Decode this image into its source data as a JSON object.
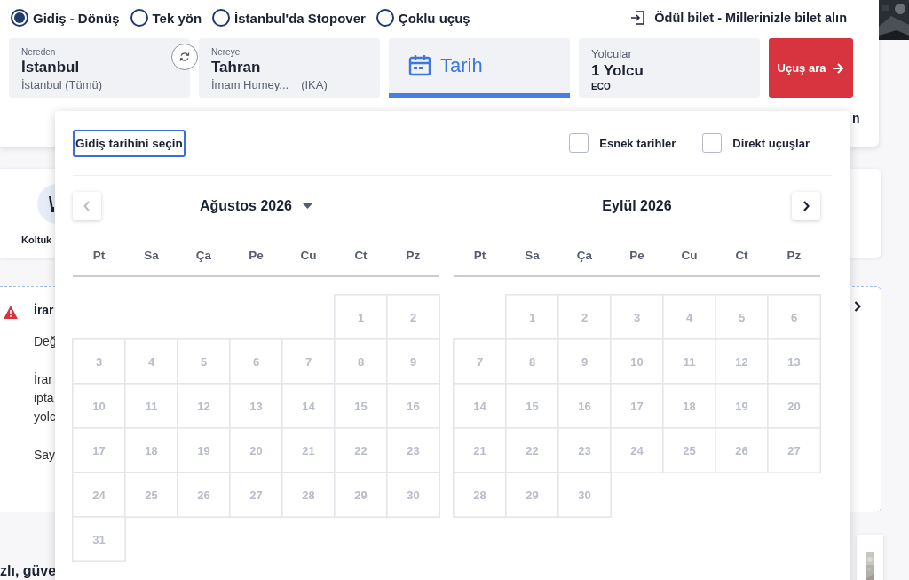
{
  "trip_types": [
    {
      "label": "Gidiş - Dönüş",
      "selected": true
    },
    {
      "label": "Tek yön",
      "selected": false
    },
    {
      "label": "İstanbul'da Stopover",
      "selected": false
    },
    {
      "label": "Çoklu uçuş",
      "selected": false
    }
  ],
  "award_link": {
    "label": "Ödül bilet - Millerinizle bilet alın"
  },
  "search": {
    "origin": {
      "label": "Nereden",
      "city": "İstanbul",
      "airport": "İstanbul (Tümü)"
    },
    "destination": {
      "label": "Nereye",
      "city": "Tahran",
      "airport": "İmam Humey...",
      "code": "(IKA)"
    },
    "date": {
      "label": "Tarih",
      "selected": true
    },
    "passengers": {
      "label": "Yolcular",
      "count": "1 Yolcu",
      "cabin": "ECO"
    },
    "button": "Uçuş ara"
  },
  "background": {
    "header_fragment": "n",
    "services": [
      {
        "label": "Koltuk"
      }
    ],
    "notice": {
      "title": "İrar",
      "paragraphs": [
        [
          "Değ"
        ],
        [
          "İrar",
          "ipta",
          "yolc"
        ],
        [
          "Say"
        ]
      ]
    },
    "footer_heading": "zlı, güve"
  },
  "date_picker": {
    "prompt": "Gidiş tarihini seçin",
    "options": [
      {
        "label": "Esnek tarihler",
        "checked": false
      },
      {
        "label": "Direkt uçuşlar",
        "checked": false
      }
    ],
    "prev": {
      "disabled": true
    },
    "next": {
      "disabled": false
    },
    "months": [
      {
        "title": "Ağustos 2026",
        "dropdown": true,
        "weekdays": [
          "Pt",
          "Sa",
          "Ça",
          "Pe",
          "Cu",
          "Ct",
          "Pz"
        ],
        "days": [
          {
            "kind": "blank"
          },
          {
            "kind": "blank"
          },
          {
            "kind": "blank"
          },
          {
            "kind": "blank"
          },
          {
            "kind": "blank"
          },
          {
            "kind": "day",
            "label": "1",
            "disabled": true
          },
          {
            "kind": "day",
            "label": "2",
            "disabled": true
          },
          {
            "kind": "day",
            "label": "3",
            "disabled": true
          },
          {
            "kind": "day",
            "label": "4",
            "disabled": true
          },
          {
            "kind": "day",
            "label": "5",
            "disabled": true
          },
          {
            "kind": "day",
            "label": "6",
            "disabled": true
          },
          {
            "kind": "day",
            "label": "7",
            "disabled": true
          },
          {
            "kind": "day",
            "label": "8",
            "disabled": true
          },
          {
            "kind": "day",
            "label": "9",
            "disabled": true
          },
          {
            "kind": "day",
            "label": "10",
            "disabled": true
          },
          {
            "kind": "day",
            "label": "11",
            "disabled": true
          },
          {
            "kind": "day",
            "label": "12",
            "disabled": true
          },
          {
            "kind": "day",
            "label": "13",
            "disabled": true
          },
          {
            "kind": "day",
            "label": "14",
            "disabled": true
          },
          {
            "kind": "day",
            "label": "15",
            "disabled": true
          },
          {
            "kind": "day",
            "label": "16",
            "disabled": true
          },
          {
            "kind": "day",
            "label": "17",
            "disabled": true
          },
          {
            "kind": "day",
            "label": "18",
            "disabled": true
          },
          {
            "kind": "day",
            "label": "19",
            "disabled": true
          },
          {
            "kind": "day",
            "label": "20",
            "disabled": true
          },
          {
            "kind": "day",
            "label": "21",
            "disabled": true
          },
          {
            "kind": "day",
            "label": "22",
            "disabled": true
          },
          {
            "kind": "day",
            "label": "23",
            "disabled": true
          },
          {
            "kind": "day",
            "label": "24",
            "disabled": true
          },
          {
            "kind": "day",
            "label": "25",
            "disabled": true
          },
          {
            "kind": "day",
            "label": "26",
            "disabled": true
          },
          {
            "kind": "day",
            "label": "27",
            "disabled": true
          },
          {
            "kind": "day",
            "label": "28",
            "disabled": true
          },
          {
            "kind": "day",
            "label": "29",
            "disabled": true
          },
          {
            "kind": "day",
            "label": "30",
            "disabled": true
          },
          {
            "kind": "day",
            "label": "31",
            "disabled": true
          }
        ]
      },
      {
        "title": "Eylül 2026",
        "dropdown": false,
        "weekdays": [
          "Pt",
          "Sa",
          "Ça",
          "Pe",
          "Cu",
          "Ct",
          "Pz"
        ],
        "days": [
          {
            "kind": "blank"
          },
          {
            "kind": "day",
            "label": "1",
            "disabled": true
          },
          {
            "kind": "day",
            "label": "2",
            "disabled": true
          },
          {
            "kind": "day",
            "label": "3",
            "disabled": true
          },
          {
            "kind": "day",
            "label": "4",
            "disabled": true
          },
          {
            "kind": "day",
            "label": "5",
            "disabled": true
          },
          {
            "kind": "day",
            "label": "6",
            "disabled": true
          },
          {
            "kind": "day",
            "label": "7",
            "disabled": true
          },
          {
            "kind": "day",
            "label": "8",
            "disabled": true
          },
          {
            "kind": "day",
            "label": "9",
            "disabled": true
          },
          {
            "kind": "day",
            "label": "10",
            "disabled": true
          },
          {
            "kind": "day",
            "label": "11",
            "disabled": true
          },
          {
            "kind": "day",
            "label": "12",
            "disabled": true
          },
          {
            "kind": "day",
            "label": "13",
            "disabled": true
          },
          {
            "kind": "day",
            "label": "14",
            "disabled": true
          },
          {
            "kind": "day",
            "label": "15",
            "disabled": true
          },
          {
            "kind": "day",
            "label": "16",
            "disabled": true
          },
          {
            "kind": "day",
            "label": "17",
            "disabled": true
          },
          {
            "kind": "day",
            "label": "18",
            "disabled": true
          },
          {
            "kind": "day",
            "label": "19",
            "disabled": true
          },
          {
            "kind": "day",
            "label": "20",
            "disabled": true
          },
          {
            "kind": "day",
            "label": "21",
            "disabled": true
          },
          {
            "kind": "day",
            "label": "22",
            "disabled": true
          },
          {
            "kind": "day",
            "label": "23",
            "disabled": true
          },
          {
            "kind": "day",
            "label": "24",
            "disabled": true
          },
          {
            "kind": "day",
            "label": "25",
            "disabled": true
          },
          {
            "kind": "day",
            "label": "26",
            "disabled": true
          },
          {
            "kind": "day",
            "label": "27",
            "disabled": true
          },
          {
            "kind": "day",
            "label": "28",
            "disabled": true
          },
          {
            "kind": "day",
            "label": "29",
            "disabled": true
          },
          {
            "kind": "day",
            "label": "30",
            "disabled": true
          }
        ]
      }
    ]
  }
}
